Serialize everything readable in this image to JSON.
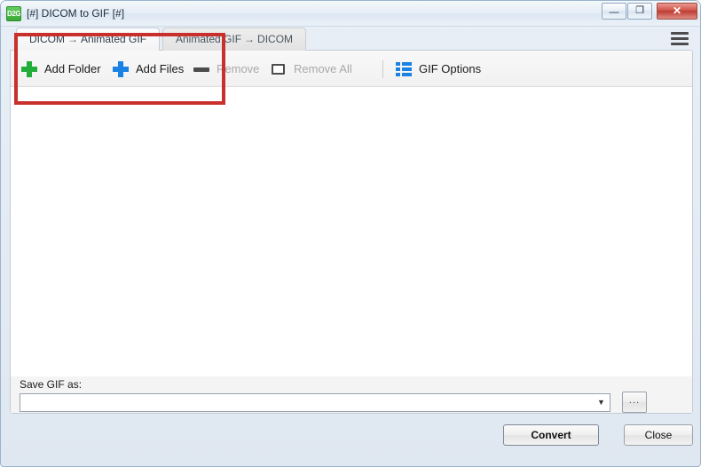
{
  "window": {
    "title": "[#] DICOM to GIF [#]",
    "app_icon_label": "D2G",
    "controls": {
      "minimize": "—",
      "maximize": "❐",
      "close": "✕"
    }
  },
  "tabs": [
    {
      "id": "dicom-to-gif",
      "source": "DICOM",
      "arrow": "→",
      "target": "Animated GIF",
      "selected": true
    },
    {
      "id": "gif-to-dicom",
      "source": "Animated GIF",
      "arrow": "→",
      "target": "DICOM",
      "selected": false
    }
  ],
  "menu": {
    "icon": "hamburger-menu-icon"
  },
  "toolbar": {
    "items": [
      {
        "id": "add-folder",
        "label": "Add Folder",
        "icon": "plus-icon",
        "icon_color": "#23ad3a",
        "disabled": false
      },
      {
        "id": "add-files",
        "label": "Add Files",
        "icon": "plus-icon",
        "icon_color": "#1a82e2",
        "disabled": false
      },
      {
        "id": "remove",
        "label": "Remove",
        "icon": "minus-icon",
        "icon_color": "#4c4c4c",
        "disabled": true
      },
      {
        "id": "remove-all",
        "label": "Remove All",
        "icon": "square-icon",
        "icon_color": "#4c4c4c",
        "disabled": true
      },
      {
        "id": "gif-options",
        "label": "GIF Options",
        "icon": "list-icon",
        "icon_color": "#1a82e2",
        "disabled": false
      }
    ]
  },
  "file_list": {
    "rows": [],
    "empty_text": ""
  },
  "save_section": {
    "label": "Save GIF as:",
    "path_value": "",
    "path_placeholder": "",
    "dropdown_glyph": "▼",
    "browse_label": "..."
  },
  "footer": {
    "convert_label": "Convert",
    "close_label": "Close"
  },
  "annotation": {
    "color": "#c9302c",
    "shape": "rectangle"
  }
}
